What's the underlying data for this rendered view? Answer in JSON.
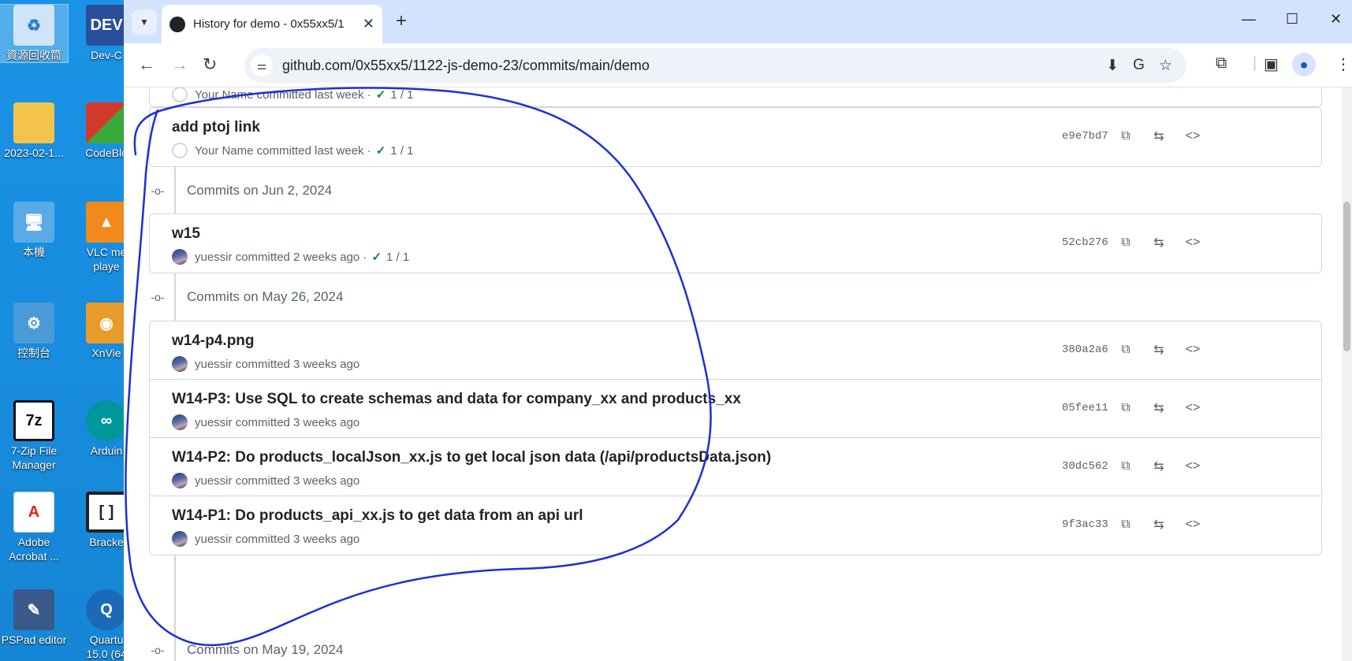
{
  "desktop": {
    "icons": [
      {
        "label": "資源回收筒",
        "icon": "recycle-bin-icon",
        "color": "#7fb3e8"
      },
      {
        "label": "Dev-C",
        "icon": "devcpp-icon",
        "color": "#2a4f9a"
      },
      {
        "label": "2023-02-1...",
        "icon": "folder-icon",
        "color": "#f2c34d"
      },
      {
        "label": "CodeBlo",
        "icon": "codeblocks-icon",
        "color": "#d43a2c"
      },
      {
        "label": "本機",
        "icon": "computer-icon",
        "color": "#5aaae8"
      },
      {
        "label": "VLC me\nplaye",
        "icon": "vlc-icon",
        "color": "#f08a1c"
      },
      {
        "label": "控制台",
        "icon": "control-panel-icon",
        "color": "#4a9ad8"
      },
      {
        "label": "XnVie",
        "icon": "xnview-icon",
        "color": "#e89a2a"
      },
      {
        "label": "7-Zip File\nManager",
        "icon": "7zip-icon",
        "color": "#111111"
      },
      {
        "label": "Arduin",
        "icon": "arduino-icon",
        "color": "#00979c"
      },
      {
        "label": "Adobe\nAcrobat ...",
        "icon": "acrobat-icon",
        "color": "#e1261c"
      },
      {
        "label": "Bracke",
        "icon": "brackets-icon",
        "color": "#222222"
      },
      {
        "label": "PSPad editor",
        "icon": "pspad-icon",
        "color": "#3a5a8a"
      },
      {
        "label": "Quartu\n15.0 (64",
        "icon": "quartus-icon",
        "color": "#1a6ab8"
      }
    ]
  },
  "browser": {
    "tab_title": "History for demo - 0x55xx5/1",
    "url": "github.com/0x55xx5/1122-js-demo-23/commits/main/demo"
  },
  "commits": {
    "partial_top": {
      "author": "Your Name",
      "text": "committed last week",
      "checks": "1 / 1"
    },
    "card1": [
      {
        "message": "add ptoj link",
        "author": "Your Name",
        "time": "committed last week",
        "checks": "1 / 1",
        "sha": "e9e7bd7"
      }
    ],
    "group1": "Commits on Jun 2, 2024",
    "card2": [
      {
        "message": "w15",
        "author": "yuessir",
        "time": "committed 2 weeks ago",
        "checks": "1 / 1",
        "sha": "52cb276"
      }
    ],
    "group2": "Commits on May 26, 2024",
    "card3": [
      {
        "message": "w14-p4.png",
        "author": "yuessir",
        "time": "committed 3 weeks ago",
        "sha": "380a2a6"
      },
      {
        "message": "W14-P3: Use SQL to create schemas and data for company_xx and products_xx",
        "author": "yuessir",
        "time": "committed 3 weeks ago",
        "sha": "05fee11"
      },
      {
        "message": "W14-P2: Do products_localJson_xx.js to get local json data (/api/productsData.json)",
        "author": "yuessir",
        "time": "committed 3 weeks ago",
        "sha": "30dc562"
      },
      {
        "message": "W14-P1: Do products_api_xx.js to get data from an api url",
        "author": "yuessir",
        "time": "committed 3 weeks ago",
        "sha": "9f3ac33"
      }
    ],
    "group3": "Commits on May 19, 2024"
  },
  "colors": {
    "annotation": "#1e2fd6",
    "check": "#1a7f37"
  }
}
